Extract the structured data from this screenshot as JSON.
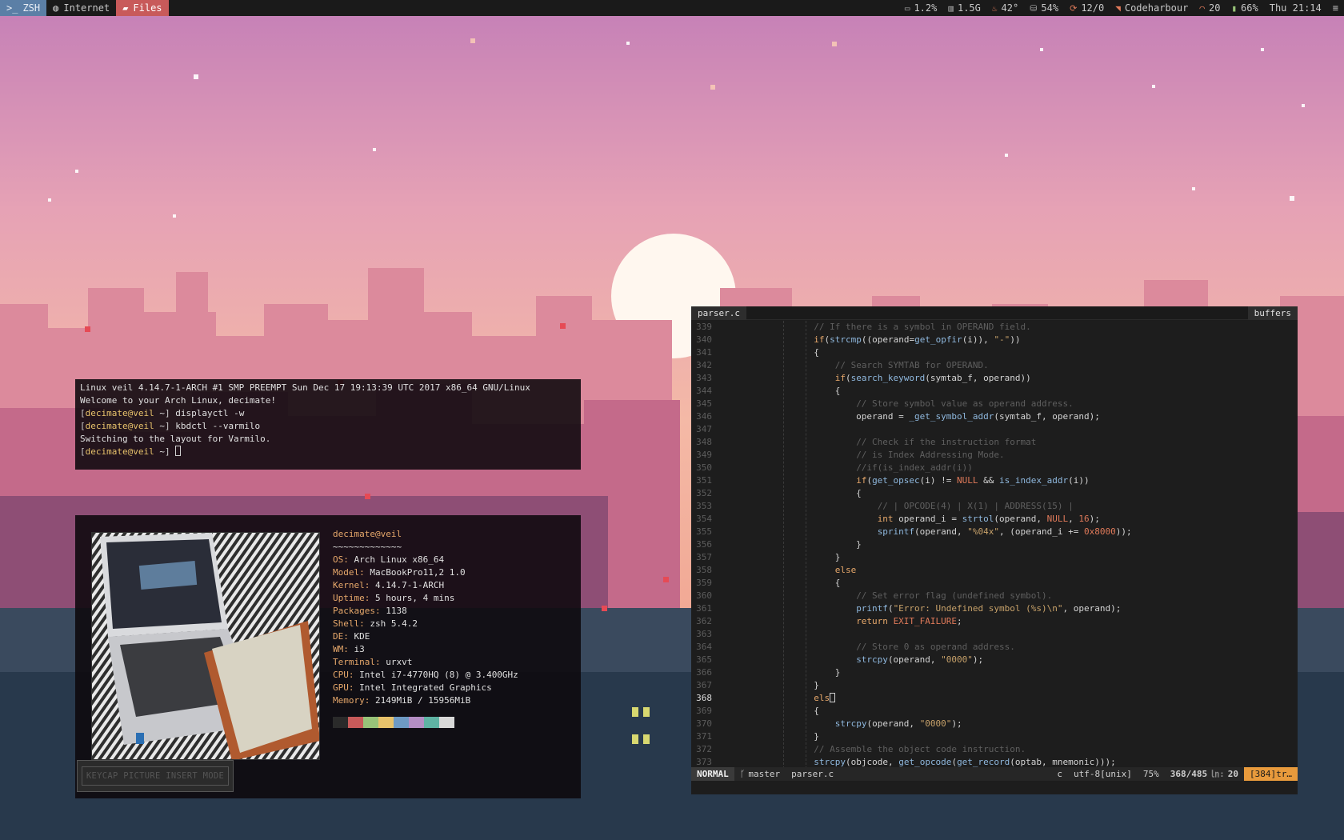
{
  "topbar": {
    "workspaces": [
      {
        "icon": ">_",
        "label": "ZSH",
        "state": "active"
      },
      {
        "icon": "globe-icon",
        "label": "Internet",
        "state": "normal"
      },
      {
        "icon": "folder-icon",
        "label": "Files",
        "state": "urgent"
      }
    ],
    "stats": {
      "cpu": "1.2%",
      "memory": "1.5G",
      "temperature": "42°",
      "disk": "54%",
      "updates": "12/0",
      "network": "Codeharbour",
      "volume": "20",
      "battery": "66%",
      "datetime": "Thu 21:14"
    }
  },
  "terminal": {
    "lines": [
      {
        "type": "out",
        "text": "Linux veil 4.14.7-1-ARCH #1 SMP PREEMPT Sun Dec 17 19:13:39 UTC 2017 x86_64 GNU/Linux"
      },
      {
        "type": "out",
        "text": "Welcome to your Arch Linux, decimate!"
      },
      {
        "type": "prompt",
        "user": "decimate@veil",
        "dir": "~",
        "cmd": "displayctl -w"
      },
      {
        "type": "prompt",
        "user": "decimate@veil",
        "dir": "~",
        "cmd": "kbdctl --varmilo"
      },
      {
        "type": "out",
        "text": "Switching to the layout for Varmilo."
      },
      {
        "type": "prompt",
        "user": "decimate@veil",
        "dir": "~",
        "cmd": ""
      }
    ]
  },
  "fetch": {
    "userhost": "decimate@veil",
    "underline": "~~~~~~~~~~~~~",
    "rows": [
      {
        "key": "OS",
        "value": "Arch Linux x86_64"
      },
      {
        "key": "Model",
        "value": "MacBookPro11,2 1.0"
      },
      {
        "key": "Kernel",
        "value": "4.14.7-1-ARCH"
      },
      {
        "key": "Uptime",
        "value": "5 hours, 4 mins"
      },
      {
        "key": "Packages",
        "value": "1138"
      },
      {
        "key": "Shell",
        "value": "zsh 5.4.2"
      },
      {
        "key": "DE",
        "value": "KDE"
      },
      {
        "key": "WM",
        "value": "i3"
      },
      {
        "key": "Terminal",
        "value": "urxvt"
      },
      {
        "key": "CPU",
        "value": "Intel i7-4770HQ (8) @ 3.400GHz"
      },
      {
        "key": "GPU",
        "value": "Intel Integrated Graphics"
      },
      {
        "key": "Memory",
        "value": "2149MiB / 15956MiB"
      }
    ],
    "palette": [
      "#2a2a2a",
      "#c85a5a",
      "#98c379",
      "#e7c26b",
      "#6e9ac4",
      "#b48ec4",
      "#5fb3a4",
      "#d8d8d8"
    ],
    "caption": "KEYCAP PICTURE INSERT MODE"
  },
  "vim": {
    "tab_label": "parser.c",
    "buffers_label": "buffers",
    "current_line": 368,
    "status": {
      "mode": "NORMAL",
      "branch": "master",
      "file": "parser.c",
      "filetype": "c",
      "encoding": "utf-8[unix]",
      "percent": "75%",
      "position": "368/485",
      "column": "20",
      "warning": "[384]tr…"
    }
  },
  "colors": {
    "topbar_bg": "#1a1a1a",
    "workspace_active": "#5b7fa6",
    "workspace_urgent": "#c85a5a",
    "accent_orange": "#e7a86b",
    "prompt_yellow": "#e7c26b",
    "vim_bg": "#1d1d1d"
  }
}
